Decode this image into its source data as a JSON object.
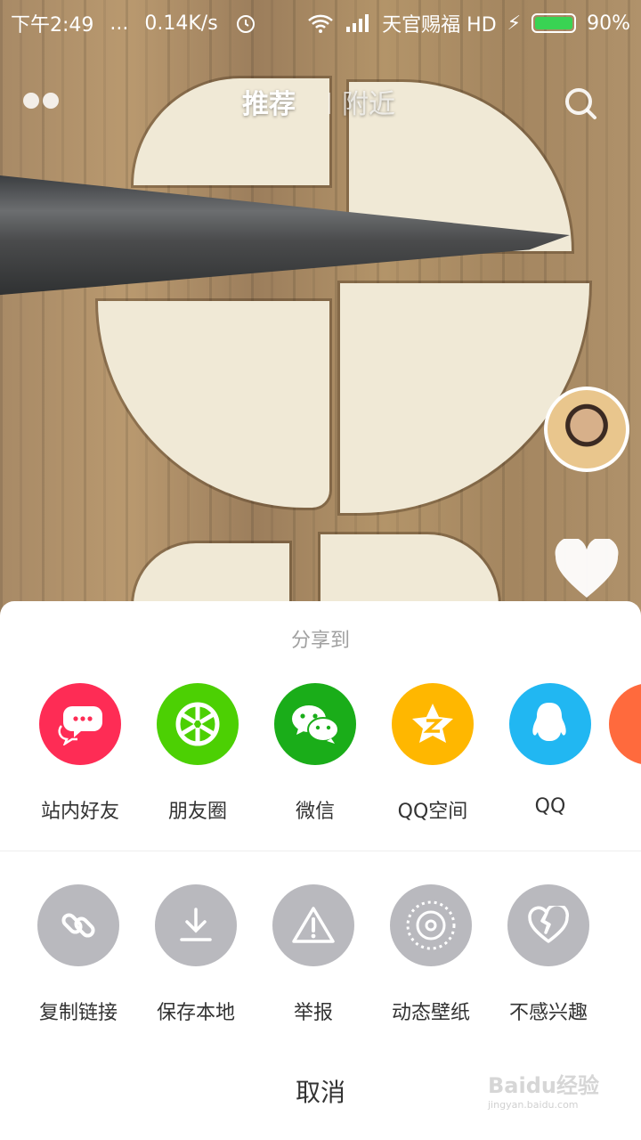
{
  "status_bar": {
    "time": "下午2:49",
    "dots": "...",
    "speed": "0.14K/s",
    "carrier": "天官赐福 HD",
    "battery": "90%"
  },
  "top_nav": {
    "tabs": [
      {
        "label": "推荐",
        "active": true
      },
      {
        "label": "附近",
        "active": false
      }
    ]
  },
  "share_sheet": {
    "title": "分享到",
    "share_targets": [
      {
        "label": "站内好友",
        "icon": "chat-bubble-icon",
        "color": "#FE2C55"
      },
      {
        "label": "朋友圈",
        "icon": "moments-shutter-icon",
        "color": "#4CD003"
      },
      {
        "label": "微信",
        "icon": "wechat-icon",
        "color": "#1AAD19"
      },
      {
        "label": "QQ空间",
        "icon": "qzone-star-icon",
        "color": "#FFB700"
      },
      {
        "label": "QQ",
        "icon": "qq-penguin-icon",
        "color": "#21B7F2"
      }
    ],
    "actions": [
      {
        "label": "复制链接",
        "icon": "link-icon"
      },
      {
        "label": "保存本地",
        "icon": "download-icon"
      },
      {
        "label": "举报",
        "icon": "warning-icon"
      },
      {
        "label": "动态壁纸",
        "icon": "live-wallpaper-icon"
      },
      {
        "label": "不感兴趣",
        "icon": "broken-heart-icon"
      }
    ],
    "action_color": "#B9B9BE",
    "cancel_label": "取消"
  },
  "watermark": {
    "text": "Baidu经验",
    "url": "jingyan.baidu.com"
  }
}
